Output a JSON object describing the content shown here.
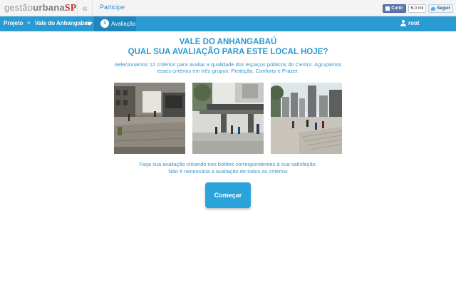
{
  "header": {
    "logo": {
      "part1": "gestão",
      "part2": "urbana",
      "part3": "SP"
    },
    "collapse_icon": "double-chevron-left-icon",
    "participe_link": "Participe",
    "social": {
      "fb_like_label": "Curtir",
      "fb_count": "6,0 mil",
      "tw_follow_label": "Seguir"
    }
  },
  "navbar": {
    "projeto": "Projeto",
    "separator": "»",
    "location": "Vale do Anhangabaú",
    "step_number": "1",
    "step_label": "Avaliação",
    "user": "root"
  },
  "main": {
    "title_line1": "VALE DO ANHANGABAÚ",
    "title_line2": "QUAL SUA AVALIAÇÃO PARA ESTE LOCAL HOJE?",
    "intro": "Selecionamos 12 critérios para avaliar a qualidade dos espaços públicos do Centro. Agrupamos esses critérios em três grupos: Proteção, Conforto e Prazer.",
    "instruction_line1": "Faça sua avaliação clicando nos botões correspondentes à sua satisfação.",
    "instruction_line2": "Não é necessária a avaliação de todos os critérios",
    "start_button": "Começar"
  },
  "colors": {
    "accent": "#2a9ad3",
    "nav_step": "#1f85bd",
    "logo_sp": "#c0392b"
  }
}
